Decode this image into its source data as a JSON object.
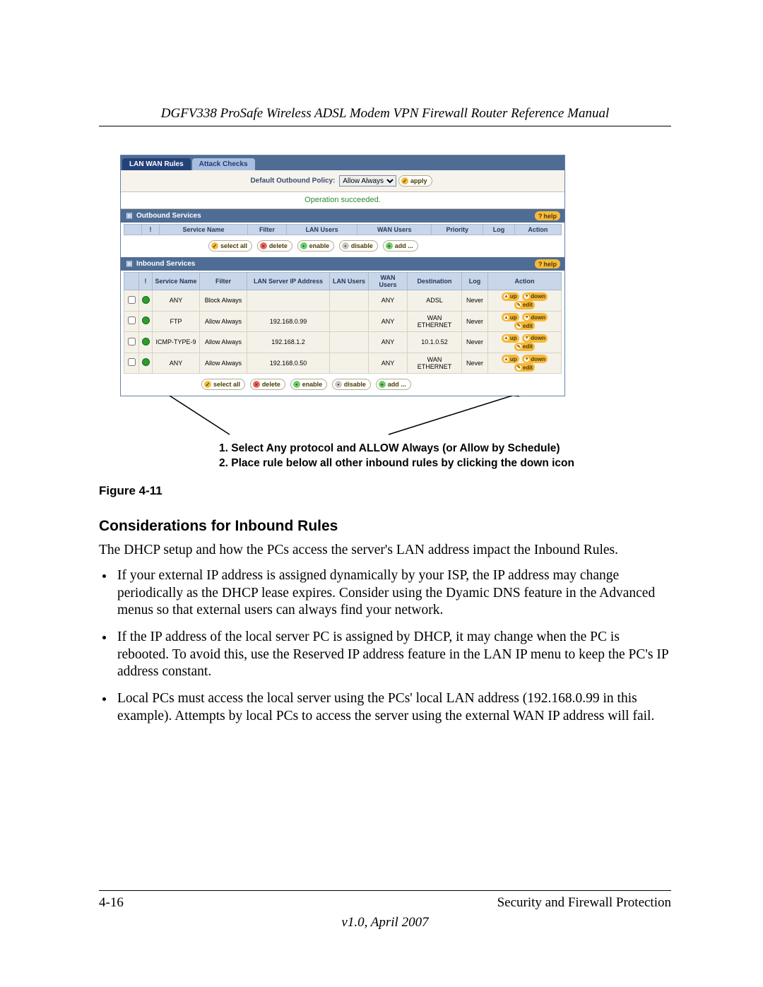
{
  "doc": {
    "header": "DGFV338 ProSafe Wireless ADSL Modem VPN Firewall Router Reference Manual",
    "figure_label": "Figure 4-11",
    "heading": "Considerations for Inbound Rules",
    "intro": "The DHCP setup and how the PCs access the server's LAN address impact the Inbound Rules.",
    "bullets": [
      "If your external IP address is assigned dynamically by your ISP, the IP address may change periodically as the DHCP lease expires. Consider using the Dyamic DNS feature in the Advanced menus so that external users can always find your network.",
      "If the IP address of the local server PC is assigned by DHCP, it may change when the PC is rebooted. To avoid this, use the Reserved IP address feature in the LAN IP menu to keep the PC's IP address constant.",
      "Local PCs must access the local server using the PCs' local LAN address (192.168.0.99 in this example). Attempts by local PCs to access the server using the external WAN IP address will fail."
    ],
    "caption1": "1. Select Any protocol and ALLOW Always (or Allow by Schedule)",
    "caption2": "2. Place rule below all other inbound rules by clicking the down icon",
    "footer_page": "4-16",
    "footer_chapter": "Security and Firewall Protection",
    "footer_version": "v1.0, April 2007"
  },
  "ui": {
    "tabs": {
      "active": "LAN WAN Rules",
      "inactive": "Attack Checks"
    },
    "policy": {
      "label": "Default Outbound Policy:",
      "value": "Allow Always",
      "apply": "apply"
    },
    "status": "Operation succeeded.",
    "help": "help",
    "outbound": {
      "title": "Outbound Services",
      "headers": [
        "!",
        "Service Name",
        "Filter",
        "LAN Users",
        "WAN Users",
        "Priority",
        "Log",
        "Action"
      ]
    },
    "inbound": {
      "title": "Inbound Services",
      "headers": [
        "!",
        "Service Name",
        "Filter",
        "LAN Server IP Address",
        "LAN Users",
        "WAN Users",
        "Destination",
        "Log",
        "Action"
      ],
      "rows": [
        {
          "svc": "ANY",
          "filter": "Block Always",
          "ip": "",
          "lan": "",
          "wan": "ANY",
          "dest": "ADSL",
          "log": "Never"
        },
        {
          "svc": "FTP",
          "filter": "Allow Always",
          "ip": "192.168.0.99",
          "lan": "",
          "wan": "ANY",
          "dest": "WAN ETHERNET",
          "log": "Never"
        },
        {
          "svc": "ICMP-TYPE-9",
          "filter": "Allow Always",
          "ip": "192.168.1.2",
          "lan": "",
          "wan": "ANY",
          "dest": "10.1.0.52",
          "log": "Never"
        },
        {
          "svc": "ANY",
          "filter": "Allow Always",
          "ip": "192.168.0.50",
          "lan": "",
          "wan": "ANY",
          "dest": "WAN ETHERNET",
          "log": "Never"
        }
      ]
    },
    "buttons": {
      "select_all": "select all",
      "delete": "delete",
      "enable": "enable",
      "disable": "disable",
      "add": "add ...",
      "up": "up",
      "down": "down",
      "edit": "edit"
    }
  }
}
